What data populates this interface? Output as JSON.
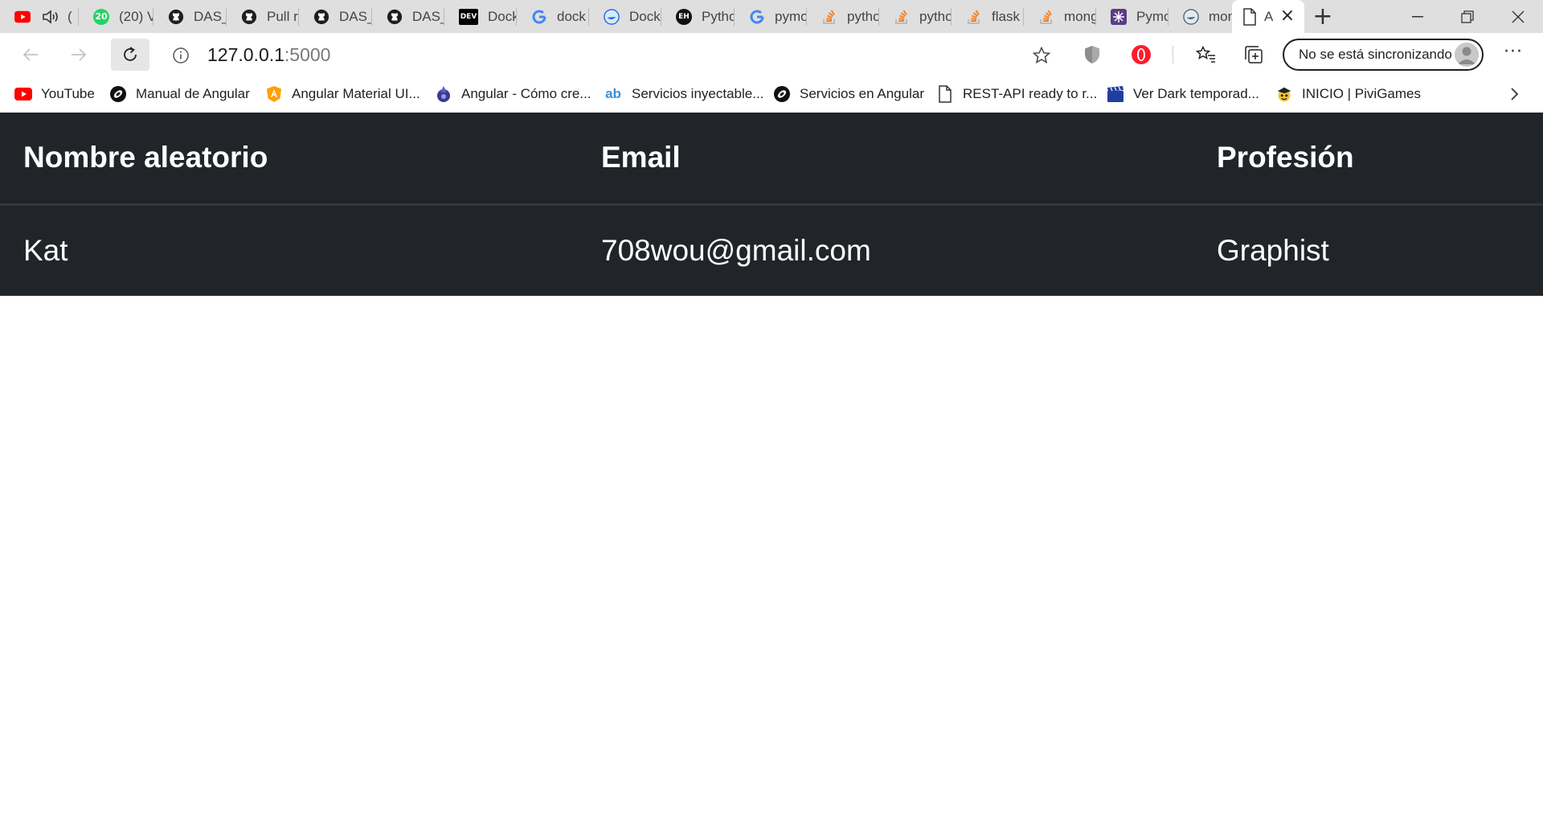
{
  "browser": {
    "tabs": [
      {
        "title": "(",
        "favicon": "youtube-icon",
        "has_audio": true
      },
      {
        "title": "(20) V",
        "favicon": "whatsapp-icon"
      },
      {
        "title": "DAS_",
        "favicon": "github-icon"
      },
      {
        "title": "Pull r",
        "favicon": "github-icon"
      },
      {
        "title": "DAS_",
        "favicon": "github-icon"
      },
      {
        "title": "DAS_",
        "favicon": "github-icon"
      },
      {
        "title": "Dock",
        "favicon": "dev-icon"
      },
      {
        "title": "dock",
        "favicon": "google-icon"
      },
      {
        "title": "Dock",
        "favicon": "docker-icon"
      },
      {
        "title": "Pytho",
        "favicon": "eh-icon"
      },
      {
        "title": "pymo",
        "favicon": "google-icon"
      },
      {
        "title": "pytho",
        "favicon": "stackoverflow-icon"
      },
      {
        "title": "pytho",
        "favicon": "stackoverflow-icon"
      },
      {
        "title": "flask",
        "favicon": "stackoverflow-icon"
      },
      {
        "title": "mong",
        "favicon": "stackoverflow-icon"
      },
      {
        "title": "Pymo",
        "favicon": "pymongo-icon"
      },
      {
        "title": "mong",
        "favicon": "docker-icon"
      },
      {
        "title": "A",
        "favicon": "page-icon",
        "active": true
      }
    ],
    "address": {
      "host": "127.0.0.1",
      "port": ":5000"
    },
    "profile": {
      "sync_label": "No se está sincronizando"
    },
    "bookmarks": [
      {
        "label": "YouTube",
        "icon": "youtube-icon"
      },
      {
        "label": "Manual de Angular",
        "icon": "desarrolloweb-icon"
      },
      {
        "label": "Angular Material UI...",
        "icon": "angular-material-icon"
      },
      {
        "label": "Angular - Cómo cre...",
        "icon": "wizard-icon"
      },
      {
        "label": "Servicios inyectable...",
        "icon": "ab-icon"
      },
      {
        "label": "Servicios en Angular",
        "icon": "desarrolloweb-icon"
      },
      {
        "label": "REST-API ready to r...",
        "icon": "page-icon"
      },
      {
        "label": "Ver Dark temporad...",
        "icon": "clapperboard-icon"
      },
      {
        "label": "INICIO | PiviGames",
        "icon": "pivigames-icon"
      }
    ]
  },
  "page": {
    "table": {
      "headers": [
        "Nombre aleatorio",
        "Email",
        "Profesión"
      ],
      "rows": [
        [
          "Kat",
          "708wou@gmail.com",
          "Graphist"
        ]
      ]
    }
  },
  "colors": {
    "table_background": "#212529",
    "table_text": "#ffffff",
    "tabstrip": "#dfdfdf"
  }
}
